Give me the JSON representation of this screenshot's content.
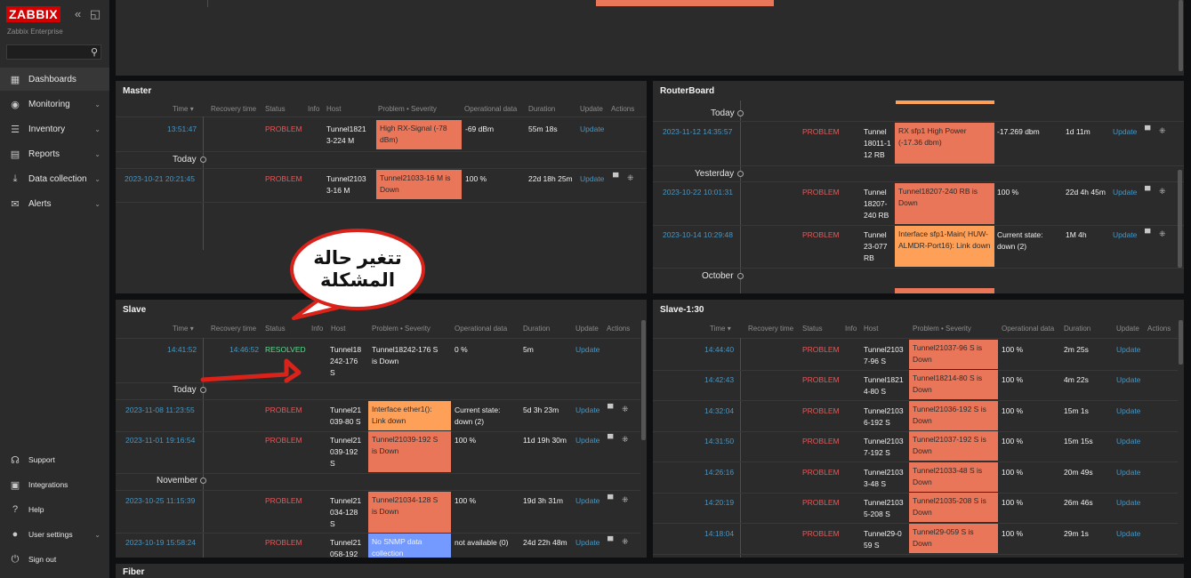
{
  "brand": {
    "logo": "ZABBIX",
    "subtitle": "Zabbix Enterprise"
  },
  "nav": {
    "items": [
      {
        "label": "Dashboards",
        "icon": "dashboard-icon"
      },
      {
        "label": "Monitoring",
        "icon": "eye-icon"
      },
      {
        "label": "Inventory",
        "icon": "list-icon"
      },
      {
        "label": "Reports",
        "icon": "report-icon"
      },
      {
        "label": "Data collection",
        "icon": "download-icon"
      },
      {
        "label": "Alerts",
        "icon": "mail-icon"
      }
    ],
    "bottom": [
      {
        "label": "Support",
        "icon": "headset-icon"
      },
      {
        "label": "Integrations",
        "icon": "z-icon"
      },
      {
        "label": "Help",
        "icon": "question-icon"
      },
      {
        "label": "User settings",
        "icon": "user-icon"
      },
      {
        "label": "Sign out",
        "icon": "power-icon"
      }
    ]
  },
  "headers": {
    "time": "Time ▾",
    "recovery": "Recovery time",
    "status": "Status",
    "info": "Info",
    "host": "Host",
    "problem": "Problem • Severity",
    "opdata": "Operational data",
    "duration": "Duration",
    "update": "Update",
    "actions": "Actions"
  },
  "master": {
    "title": "Master",
    "today": "Today",
    "rows": [
      {
        "time": "13:51:47",
        "status": "PROBLEM",
        "host1": "Tunnel1821",
        "host2": "3-224 M",
        "p1": "High RX-Signal (-78",
        "p2": "dBm)",
        "op": "-69 dBm",
        "dur": "55m 18s",
        "upd": "Update"
      },
      {
        "time": "2023-10-21 20:21:45",
        "status": "PROBLEM",
        "host1": "Tunnel2103",
        "host2": "3-16 M",
        "p1": "Tunnel21033-16 M is",
        "p2": "Down",
        "op": "100 %",
        "dur": "22d 18h 25m",
        "upd": "Update"
      }
    ]
  },
  "routerboard": {
    "title": "RouterBoard",
    "today": "Today",
    "yesterday": "Yesterday",
    "october": "October",
    "rows": [
      {
        "time": "2023-11-12 14:35:57",
        "status": "PROBLEM",
        "host1": "Tunnel",
        "host2": "18011-1",
        "host3": "12 RB",
        "p1": "RX sfp1 High Power",
        "p2": "(-17.36 dbm)",
        "op": "-17.269 dbm",
        "op2": "",
        "dur": "1d 11m",
        "upd": "Update"
      },
      {
        "time": "2023-10-22 10:01:31",
        "status": "PROBLEM",
        "host1": "Tunnel",
        "host2": "18207-",
        "host3": "240 RB",
        "p1": "Tunnel18207-240 RB is",
        "p2": "Down",
        "op": "100 %",
        "op2": "",
        "dur": "22d 4h 45m",
        "upd": "Update"
      },
      {
        "time": "2023-10-14 10:29:48",
        "status": "PROBLEM",
        "host1": "Tunnel",
        "host2": "23-077",
        "host3": "RB",
        "p1": "Interface sfp1-Main( HUW-",
        "p2": "ALMDR-Port16): Link down",
        "op": "Current state:",
        "op2": "down (2)",
        "dur": "1M 4h",
        "upd": "Update"
      }
    ]
  },
  "slave": {
    "title": "Slave",
    "today": "Today",
    "november": "November",
    "rows": [
      {
        "time": "14:41:52",
        "recovery": "14:46:52",
        "status": "RESOLVED",
        "host1": "Tunnel18",
        "host2": "242-176",
        "host3": "S",
        "p1": "Tunnel18242-176 S",
        "p2": "is Down",
        "op": "0 %",
        "op2": "",
        "dur": "5m",
        "upd": "Update"
      },
      {
        "time": "2023-11-08 11:23:55",
        "recovery": "",
        "status": "PROBLEM",
        "host1": "Tunnel21",
        "host2": "039-80 S",
        "host3": "",
        "p1": "Interface ether1():",
        "p2": "Link down",
        "op": "Current state:",
        "op2": "down (2)",
        "dur": "5d 3h 23m",
        "upd": "Update"
      },
      {
        "time": "2023-11-01 19:16:54",
        "recovery": "",
        "status": "PROBLEM",
        "host1": "Tunnel21",
        "host2": "039-192",
        "host3": "S",
        "p1": "Tunnel21039-192 S",
        "p2": "is Down",
        "op": "100 %",
        "op2": "",
        "dur": "11d 19h 30m",
        "upd": "Update"
      },
      {
        "time": "2023-10-25 11:15:39",
        "recovery": "",
        "status": "PROBLEM",
        "host1": "Tunnel21",
        "host2": "034-128",
        "host3": "S",
        "p1": "Tunnel21034-128 S",
        "p2": "is Down",
        "op": "100 %",
        "op2": "",
        "dur": "19d 3h 31m",
        "upd": "Update"
      },
      {
        "time": "2023-10-19 15:58:24",
        "recovery": "",
        "status": "PROBLEM",
        "host1": "Tunnel21",
        "host2": "058-192",
        "host3": "",
        "p1": "No SNMP data",
        "p2": "collection",
        "op": "not available (0)",
        "op2": "",
        "dur": "24d 22h 48m",
        "upd": "Update"
      }
    ]
  },
  "slave130": {
    "title": "Slave-1:30",
    "rows": [
      {
        "time": "14:44:40",
        "status": "PROBLEM",
        "host1": "Tunnel2103",
        "host2": "7-96 S",
        "p1": "Tunnel21037-96 S is",
        "p2": "Down",
        "op": "100 %",
        "dur": "2m 25s",
        "upd": "Update"
      },
      {
        "time": "14:42:43",
        "status": "PROBLEM",
        "host1": "Tunnel1821",
        "host2": "4-80 S",
        "p1": "Tunnel18214-80 S is",
        "p2": "Down",
        "op": "100 %",
        "dur": "4m 22s",
        "upd": "Update"
      },
      {
        "time": "14:32:04",
        "status": "PROBLEM",
        "host1": "Tunnel2103",
        "host2": "6-192 S",
        "p1": "Tunnel21036-192 S is",
        "p2": "Down",
        "op": "100 %",
        "dur": "15m 1s",
        "upd": "Update"
      },
      {
        "time": "14:31:50",
        "status": "PROBLEM",
        "host1": "Tunnel2103",
        "host2": "7-192 S",
        "p1": "Tunnel21037-192 S is",
        "p2": "Down",
        "op": "100 %",
        "dur": "15m 15s",
        "upd": "Update"
      },
      {
        "time": "14:26:16",
        "status": "PROBLEM",
        "host1": "Tunnel2103",
        "host2": "3-48 S",
        "p1": "Tunnel21033-48 S is",
        "p2": "Down",
        "op": "100 %",
        "dur": "20m 49s",
        "upd": "Update"
      },
      {
        "time": "14:20:19",
        "status": "PROBLEM",
        "host1": "Tunnel2103",
        "host2": "5-208 S",
        "p1": "Tunnel21035-208 S is",
        "p2": "Down",
        "op": "100 %",
        "dur": "26m 46s",
        "upd": "Update"
      },
      {
        "time": "14:18:04",
        "status": "PROBLEM",
        "host1": "Tunnel29-0",
        "host2": "59 S",
        "p1": "Tunnel29-059 S is",
        "p2": "Down",
        "op": "100 %",
        "dur": "29m 1s",
        "upd": "Update"
      }
    ]
  },
  "fiber": {
    "title": "Fiber"
  },
  "annotation": {
    "line1": "تتغير حالة",
    "line2": "المشكلة"
  },
  "colors": {
    "high": "#e97659",
    "average": "#ffa059",
    "info": "#7499ff",
    "problem": "#e45959",
    "resolved": "#59db8f",
    "logo": "#d40000",
    "arrow": "#d9221a"
  }
}
